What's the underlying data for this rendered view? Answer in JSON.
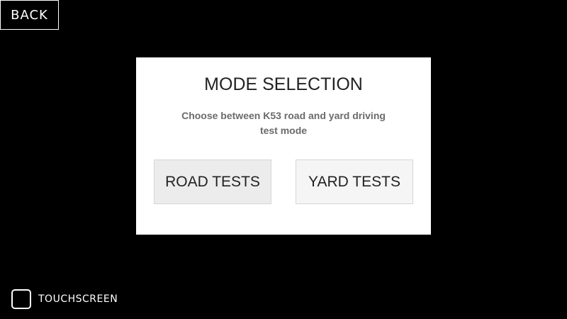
{
  "header": {
    "back_label": "BACK"
  },
  "dialog": {
    "title": "MODE SELECTION",
    "subtitle_line1": "Choose between K53 road and yard driving",
    "subtitle_line2": "test mode",
    "road_button_label": "ROAD TESTS",
    "yard_button_label": "YARD TESTS"
  },
  "footer": {
    "touchscreen_label": "TOUCHSCREEN",
    "touchscreen_checked": false
  },
  "colors": {
    "background": "#000000",
    "dialog_background": "#ffffff",
    "text_dark": "#222222",
    "text_muted": "#6b6b6b"
  }
}
